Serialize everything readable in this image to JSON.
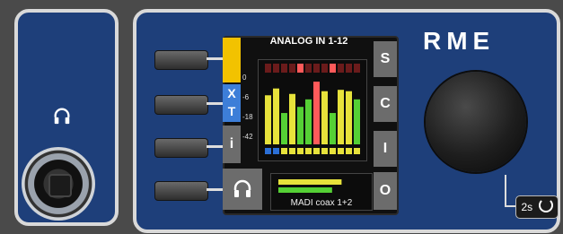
{
  "device": {
    "brand": "RME",
    "headphone_jack": {
      "icon": "headphones-icon"
    },
    "buttons": [
      {
        "id": "button-1"
      },
      {
        "id": "button-2"
      },
      {
        "id": "button-3"
      },
      {
        "id": "button-4"
      }
    ],
    "screen": {
      "title": "ANALOG IN 1-12",
      "left_tabs": [
        {
          "label": "",
          "color": "#f2c200"
        },
        {
          "label": "X",
          "color": "#3d7ed8"
        },
        {
          "label": "T",
          "color": "#3d7ed8"
        },
        {
          "label": "i",
          "color": "#6c6c6c"
        },
        {
          "icon": "headphones-icon",
          "color": "#6c6c6c"
        }
      ],
      "right_tabs": [
        "S",
        "C",
        "I",
        "O"
      ],
      "scale": [
        "0",
        "-6",
        "-18",
        "-42"
      ],
      "meters": {
        "channels": 12,
        "levels": [
          0.72,
          0.82,
          0.46,
          0.74,
          0.55,
          0.66,
          0.92,
          0.78,
          0.46,
          0.8,
          0.78,
          0.66
        ],
        "colors": {
          "green": "#55d035",
          "yellow": "#e7e23b",
          "red": "#ff5a5a",
          "blue": "#2b6fd6"
        }
      },
      "madi": {
        "label": "MADI coax 1+2",
        "levels": [
          0.8,
          0.68
        ]
      }
    },
    "power": {
      "label": "2s",
      "icon": "power-icon"
    }
  }
}
